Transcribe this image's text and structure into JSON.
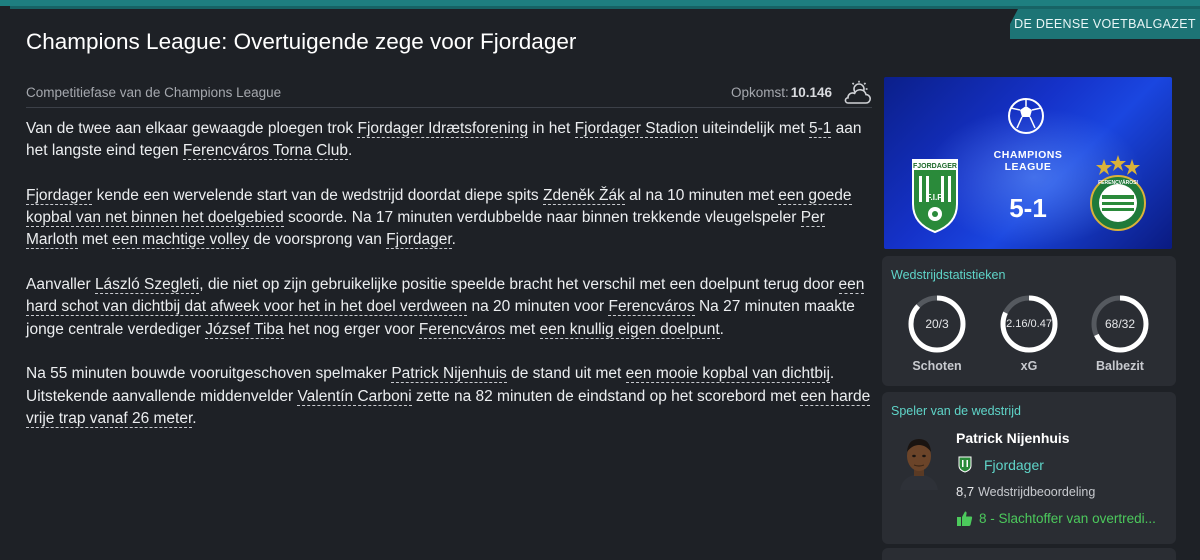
{
  "source_tag": "DE DEENSE VOETBALGAZET",
  "headline": "Champions League: Overtuigende zege voor Fjordager",
  "competition": "Competitiefase van de Champions League",
  "attendance": {
    "label": "Opkomst:",
    "value": "10.146",
    "weather_icon": "cloud-sun-icon"
  },
  "article": {
    "p1": {
      "t1": "Van de twee aan elkaar gewaagde ploegen trok ",
      "l1": "Fjordager Idrætsforening",
      "t2": " in het ",
      "l2": "Fjordager Stadion",
      "t3": " uiteindelijk met ",
      "l3": "5-1",
      "t4": " aan het langste eind tegen ",
      "l4": "Ferencváros Torna Club",
      "t5": "."
    },
    "p2": {
      "l1": "Fjordager",
      "t1": " kende een wervelende start van de wedstrijd doordat diepe spits ",
      "l2": "Zdeněk Žák",
      "t2": " al na 10 minuten met ",
      "l3": "een goede kopbal van net binnen het doelgebied",
      "t3": " scoorde. Na 17 minuten verdubbelde naar binnen trekkende vleugelspeler ",
      "l4": "Per Marloth",
      "t4": " met ",
      "l5": "een machtige volley",
      "t5": " de voorsprong van ",
      "l6": "Fjordager",
      "t6": "."
    },
    "p3": {
      "t1": "Aanvaller ",
      "l1": "László Szegleti",
      "t2": ", die niet op zijn gebruikelijke positie speelde bracht het verschil met een doelpunt terug door ",
      "l2": "een hard schot van dichtbij dat afweek voor het in het doel verdween",
      "t3": " na 20 minuten voor ",
      "l3": "Ferencváros",
      "t4": " Na 27 minuten maakte jonge centrale verdediger ",
      "l4": "József Tiba",
      "t5": " het nog erger voor ",
      "l5": "Ferencváros",
      "t6": " met ",
      "l6": "een knullig eigen doelpunt",
      "t7": "."
    },
    "p4": {
      "t1": "Na 55 minuten bouwde vooruitgeschoven spelmaker ",
      "l1": "Patrick Nijenhuis",
      "t2": " de stand uit met ",
      "l2": "een mooie kopbal van dichtbij",
      "t3": ". Uitstekende aanvallende middenvelder ",
      "l3": "Valentín Carboni",
      "t4": " zette na 82 minuten de eindstand op het scorebord met ",
      "l4": "een harde vrije trap vanaf 26 meter",
      "t5": "."
    }
  },
  "match_badge": {
    "competition_logo_lines": [
      "CHAMPIONS",
      "LEAGUE"
    ],
    "score": "5-1",
    "home_crest_lines": [
      "FJORDAGER",
      "F.I.F."
    ],
    "away_crest_text": "FERENCVÁROSI"
  },
  "stats": {
    "title": "Wedstrijdstatistieken",
    "items": [
      {
        "label": "Schoten",
        "value": "20/3",
        "share": 0.87
      },
      {
        "label": "xG",
        "value": "2.16/0.47",
        "share": 0.82
      },
      {
        "label": "Balbezit",
        "value": "68/32",
        "share": 0.68
      }
    ]
  },
  "potm": {
    "title": "Speler van de wedstrijd",
    "name": "Patrick Nijenhuis",
    "club": "Fjordager",
    "rating": "8,7",
    "rating_label": "Wedstrijdbeoordeling",
    "award": "8 - Slachtoffer van overtredi..."
  },
  "colors": {
    "accent_teal": "#5fd5c9",
    "tag_bg": "#1d7475",
    "positive_green": "#4cc95c",
    "badge_blue": "#1532c9",
    "home_green": "#2a8a3a"
  }
}
